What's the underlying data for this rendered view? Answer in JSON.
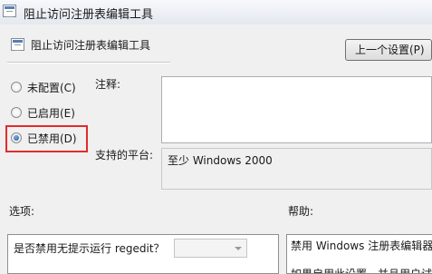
{
  "window": {
    "title": "阻止访问注册表编辑工具"
  },
  "header": {
    "setting_name": "阻止访问注册表编辑工具",
    "prev_button_label": "上一个设置(P)"
  },
  "state_options": [
    {
      "label": "未配置(C)",
      "checked": false
    },
    {
      "label": "已启用(E)",
      "checked": false
    },
    {
      "label": "已禁用(D)",
      "checked": true
    }
  ],
  "fields": {
    "comment_label": "注释:",
    "comment_value": "",
    "platform_label": "支持的平台:",
    "platform_value": "至少 Windows 2000"
  },
  "options": {
    "section_label": "选项:",
    "prompt": "是否禁用无提示运行 regedit？",
    "selected_value": ""
  },
  "help": {
    "section_label": "帮助:",
    "line1": "禁用 Windows 注册表编辑器",
    "line2": "如果启用此设置，并且用户试"
  },
  "colors": {
    "highlight": "#e52a2a"
  }
}
